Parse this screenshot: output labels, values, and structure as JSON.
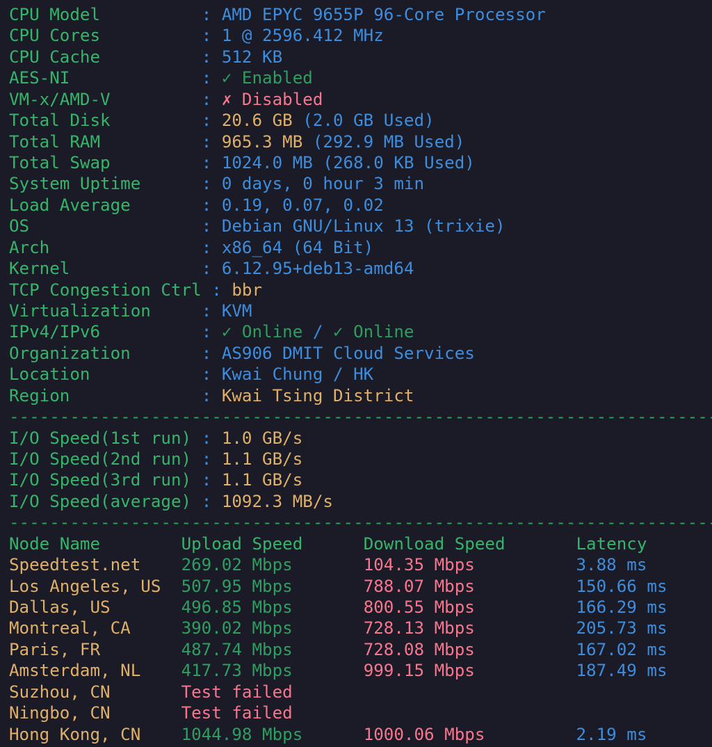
{
  "colors": {
    "background": "#1a1b26",
    "label": "#34b56a",
    "blue_value": "#3d8ddf",
    "yellow_value": "#e0af68",
    "enabled": "#2e9e60",
    "disabled": "#f7768e",
    "divider": "#2aa45b"
  },
  "info": [
    {
      "label": "CPU Model",
      "sep": ":",
      "value": "AMD EPYC 9655P 96-Core Processor",
      "tone": "blue"
    },
    {
      "label": "CPU Cores",
      "sep": ":",
      "value": "1 @ 2596.412 MHz",
      "tone": "blue"
    },
    {
      "label": "CPU Cache",
      "sep": ":",
      "value": "512 KB",
      "tone": "blue"
    },
    {
      "label": "AES-NI",
      "sep": ":",
      "value": "✓ Enabled",
      "tone": "enabled"
    },
    {
      "label": "VM-x/AMD-V",
      "sep": ":",
      "value": "✗ Disabled",
      "tone": "disabled"
    },
    {
      "label": "Total Disk",
      "sep": ":",
      "value": "20.6 GB",
      "tone": "yellow",
      "extra": " (2.0 GB Used)",
      "extra_tone": "blue"
    },
    {
      "label": "Total RAM",
      "sep": ":",
      "value": "965.3 MB",
      "tone": "yellow",
      "extra": " (292.9 MB Used)",
      "extra_tone": "blue"
    },
    {
      "label": "Total Swap",
      "sep": ":",
      "value": "1024.0 MB (268.0 KB Used)",
      "tone": "blue"
    },
    {
      "label": "System Uptime",
      "sep": ":",
      "value": "0 days, 0 hour 3 min",
      "tone": "blue"
    },
    {
      "label": "Load Average",
      "sep": ":",
      "value": "0.19, 0.07, 0.02",
      "tone": "blue"
    },
    {
      "label": "OS",
      "sep": ":",
      "value": "Debian GNU/Linux 13 (trixie)",
      "tone": "blue"
    },
    {
      "label": "Arch",
      "sep": ":",
      "value": "x86_64 (64 Bit)",
      "tone": "blue"
    },
    {
      "label": "Kernel",
      "sep": ":",
      "value": "6.12.95+deb13-amd64",
      "tone": "blue"
    },
    {
      "label": "TCP Congestion Ctrl",
      "sep": ":",
      "value": "bbr",
      "tone": "yellow"
    },
    {
      "label": "Virtualization",
      "sep": ":",
      "value": "KVM",
      "tone": "blue"
    },
    {
      "label": "IPv4/IPv6",
      "sep": ":",
      "value": "✓ Online",
      "tone": "enabled",
      "extra": " / ",
      "extra_tone": "blue",
      "extra2": "✓ Online",
      "extra2_tone": "enabled"
    },
    {
      "label": "Organization",
      "sep": ":",
      "value": "AS906 DMIT Cloud Services",
      "tone": "blue"
    },
    {
      "label": "Location",
      "sep": ":",
      "value": "Kwai Chung / HK",
      "tone": "blue"
    },
    {
      "label": "Region",
      "sep": ":",
      "value": "Kwai Tsing District",
      "tone": "yellow"
    }
  ],
  "divider": "----------------------------------------------------------------------",
  "io": [
    {
      "label": "I/O Speed(1st run)",
      "sep": ":",
      "value": "1.0 GB/s"
    },
    {
      "label": "I/O Speed(2nd run)",
      "sep": ":",
      "value": "1.1 GB/s"
    },
    {
      "label": "I/O Speed(3rd run)",
      "sep": ":",
      "value": "1.1 GB/s"
    },
    {
      "label": "I/O Speed(average)",
      "sep": ":",
      "value": "1092.3 MB/s"
    }
  ],
  "speed_header": {
    "node": "Node Name",
    "upload": "Upload Speed",
    "download": "Download Speed",
    "latency": "Latency"
  },
  "speed_rows": [
    {
      "node": "Speedtest.net",
      "upload": "269.02 Mbps",
      "download": "104.35 Mbps",
      "latency": "3.88 ms"
    },
    {
      "node": "Los Angeles, US",
      "upload": "507.95 Mbps",
      "download": "788.07 Mbps",
      "latency": "150.66 ms"
    },
    {
      "node": "Dallas, US",
      "upload": "496.85 Mbps",
      "download": "800.55 Mbps",
      "latency": "166.29 ms"
    },
    {
      "node": "Montreal, CA",
      "upload": "390.02 Mbps",
      "download": "728.13 Mbps",
      "latency": "205.73 ms"
    },
    {
      "node": "Paris, FR",
      "upload": "487.74 Mbps",
      "download": "728.08 Mbps",
      "latency": "167.02 ms"
    },
    {
      "node": "Amsterdam, NL",
      "upload": "417.73 Mbps",
      "download": "999.15 Mbps",
      "latency": "187.49 ms"
    },
    {
      "node": "Suzhou, CN",
      "failed": "Test failed"
    },
    {
      "node": "Ningbo, CN",
      "failed": "Test failed"
    },
    {
      "node": "Hong Kong, CN",
      "upload": "1044.98 Mbps",
      "download": "1000.06 Mbps",
      "latency": "2.19 ms"
    }
  ]
}
